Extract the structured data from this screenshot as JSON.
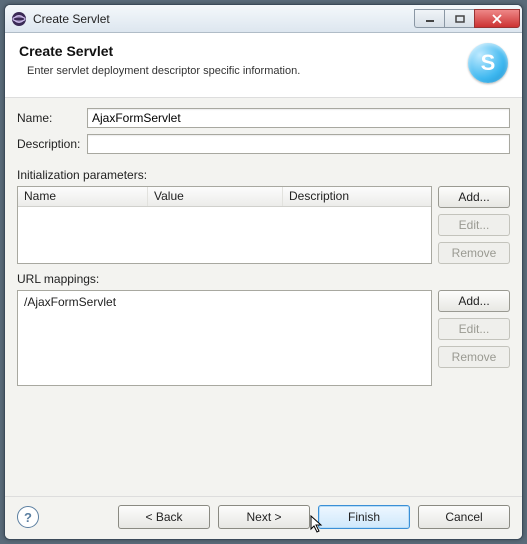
{
  "window": {
    "title": "Create Servlet"
  },
  "header": {
    "title": "Create Servlet",
    "subtitle": "Enter servlet deployment descriptor specific information.",
    "logo_letter": "S"
  },
  "form": {
    "name_label": "Name:",
    "name_value": "AjaxFormServlet",
    "description_label": "Description:",
    "description_value": ""
  },
  "params": {
    "section_label": "Initialization parameters:",
    "col_name": "Name",
    "col_value": "Value",
    "col_desc": "Description",
    "rows": [],
    "add": "Add...",
    "edit": "Edit...",
    "remove": "Remove"
  },
  "url": {
    "section_label": "URL mappings:",
    "items": [
      "/AjaxFormServlet"
    ],
    "add": "Add...",
    "edit": "Edit...",
    "remove": "Remove"
  },
  "footer": {
    "back": "< Back",
    "next": "Next >",
    "finish": "Finish",
    "cancel": "Cancel"
  }
}
